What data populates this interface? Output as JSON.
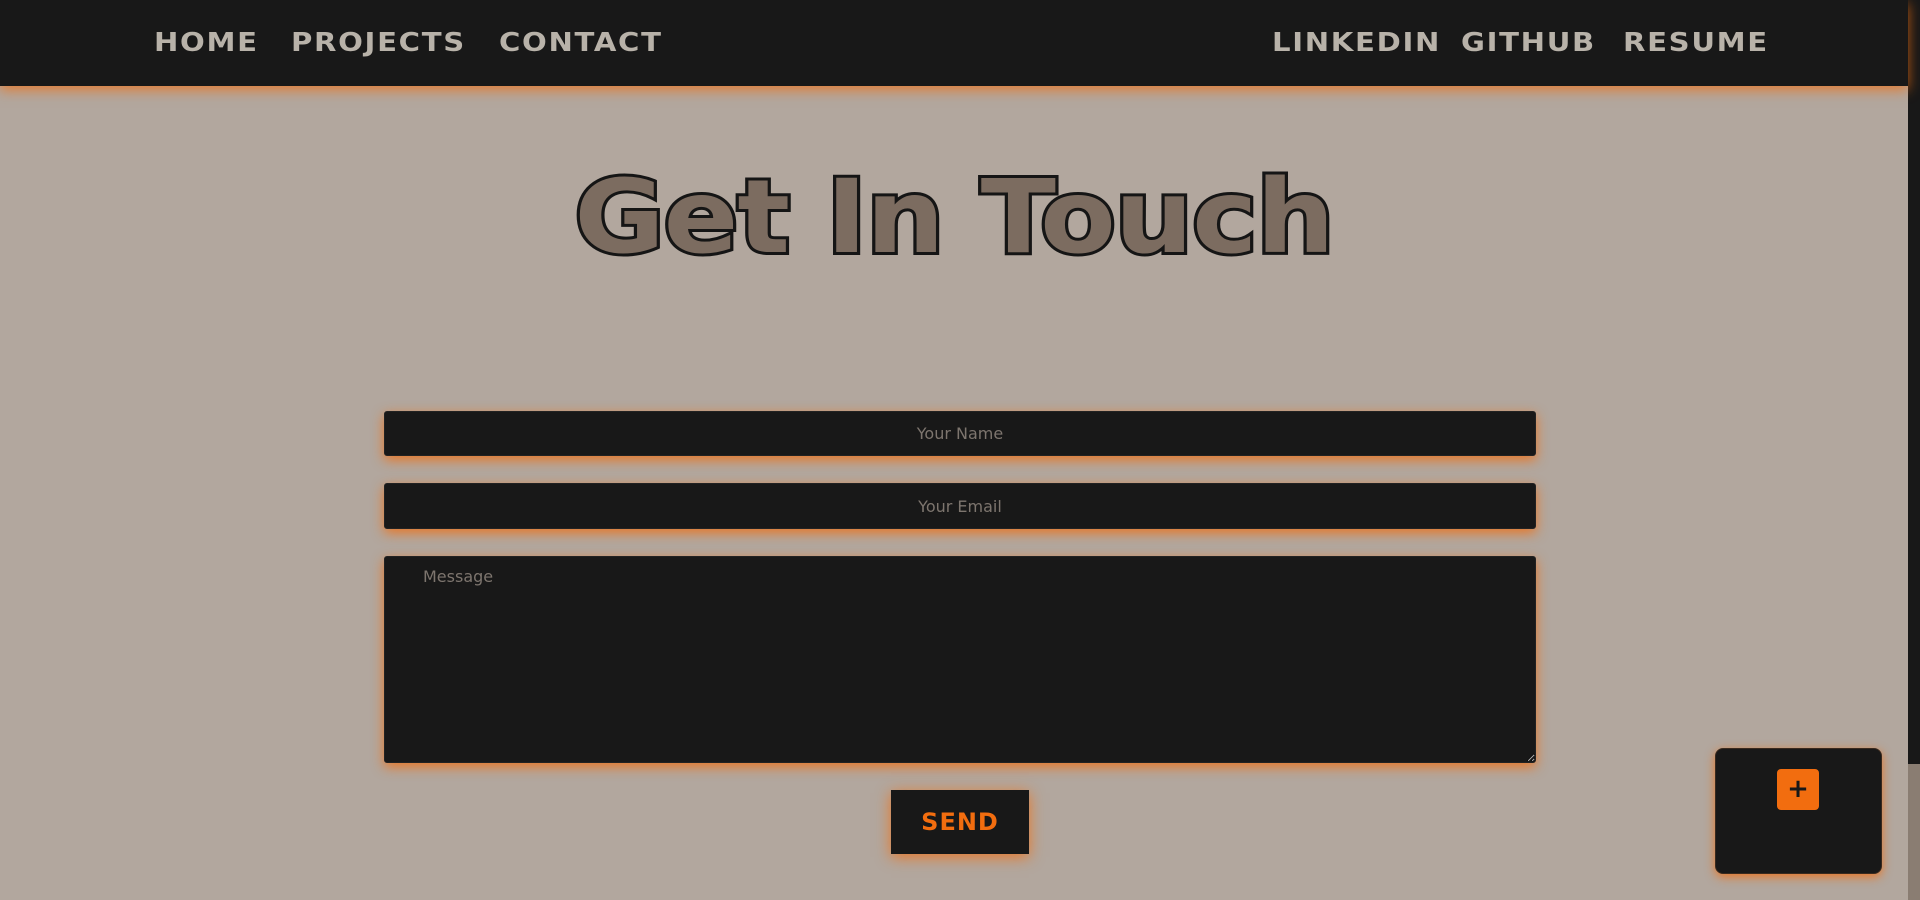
{
  "nav": {
    "left": [
      {
        "label": "HOME"
      },
      {
        "label": "PROJECTS"
      },
      {
        "label": "CONTACT"
      }
    ],
    "right": [
      {
        "label": "LINKEDIN"
      },
      {
        "label": "GITHUB"
      },
      {
        "label": "RESUME"
      }
    ]
  },
  "contact": {
    "heading": "Get In Touch",
    "name_placeholder": "Your Name",
    "name_value": "",
    "email_placeholder": "Your Email",
    "email_value": "",
    "message_placeholder": "Message",
    "message_value": "",
    "send_label": "SEND"
  },
  "widget": {
    "add_icon": "plus-icon",
    "add_glyph": "+"
  },
  "colors": {
    "background": "#b2a79e",
    "surface": "#181818",
    "accent": "#f26d0f",
    "nav_text": "#b8b2a9",
    "heading_fill": "#7c6c60"
  }
}
